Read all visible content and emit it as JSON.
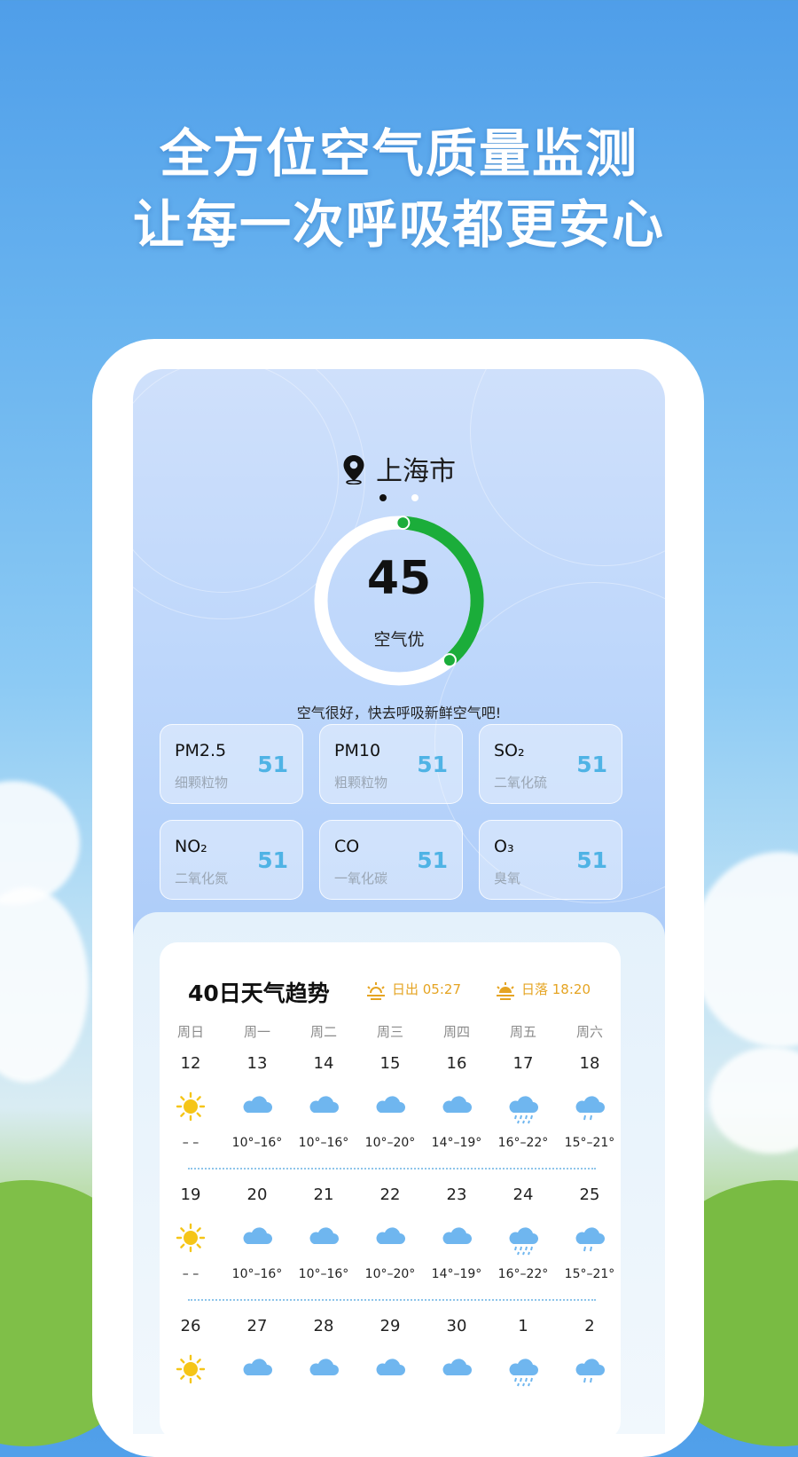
{
  "headline": {
    "line1": "全方位空气质量监测",
    "line2": "让每一次呼吸都更安心"
  },
  "location": {
    "city": "上海市",
    "page_indicator": {
      "count": 2,
      "active": 0
    }
  },
  "aqi": {
    "value": "45",
    "level": "空气优",
    "tip": "空气很好，快去呼吸新鲜空气吧!",
    "gauge_fraction": 0.38,
    "gauge_color": "#1bad3a"
  },
  "pollutants": [
    {
      "name": "PM2.5",
      "cn": "细颗粒物",
      "value": "51"
    },
    {
      "name": "PM10",
      "cn": "粗颗粒物",
      "value": "51"
    },
    {
      "name": "SO₂",
      "cn": "二氧化硫",
      "value": "51"
    },
    {
      "name": "NO₂",
      "cn": "二氧化氮",
      "value": "51"
    },
    {
      "name": "CO",
      "cn": "一氧化碳",
      "value": "51"
    },
    {
      "name": "O₃",
      "cn": "臭氧",
      "value": "51"
    }
  ],
  "forecast": {
    "title": "40日天气趋势",
    "sunrise": "日出 05:27",
    "sunset": "日落 18:20",
    "weekdays": [
      "周日",
      "周一",
      "周二",
      "周三",
      "周四",
      "周五",
      "周六"
    ],
    "weeks": [
      {
        "days": [
          "12",
          "13",
          "14",
          "15",
          "16",
          "17",
          "18"
        ],
        "icons": [
          "sun-icon",
          "cloud-icon",
          "cloud-icon",
          "cloud-icon",
          "cloud-icon",
          "heavy-rain-icon",
          "light-rain-icon"
        ],
        "temps": [
          "– –",
          "10°–16°",
          "10°–16°",
          "10°–20°",
          "14°–19°",
          "16°–22°",
          "15°–21°"
        ]
      },
      {
        "days": [
          "19",
          "20",
          "21",
          "22",
          "23",
          "24",
          "25"
        ],
        "icons": [
          "sun-icon",
          "cloud-icon",
          "cloud-icon",
          "cloud-icon",
          "cloud-icon",
          "heavy-rain-icon",
          "light-rain-icon"
        ],
        "temps": [
          "– –",
          "10°–16°",
          "10°–16°",
          "10°–20°",
          "14°–19°",
          "16°–22°",
          "15°–21°"
        ]
      },
      {
        "days": [
          "26",
          "27",
          "28",
          "29",
          "30",
          "1",
          "2"
        ],
        "icons": [
          "sun-icon",
          "cloud-icon",
          "cloud-icon",
          "cloud-icon",
          "cloud-icon",
          "heavy-rain-icon",
          "light-rain-icon"
        ],
        "temps": [
          "",
          "",
          "",
          "",
          "",
          "",
          ""
        ]
      }
    ]
  },
  "colors": {
    "accent": "#1bad3a",
    "value_blue": "#4fb3e5",
    "sun_yellow": "#f5c518",
    "cloud_blue": "#6fb6ef",
    "sun_text": "#e5a422"
  }
}
